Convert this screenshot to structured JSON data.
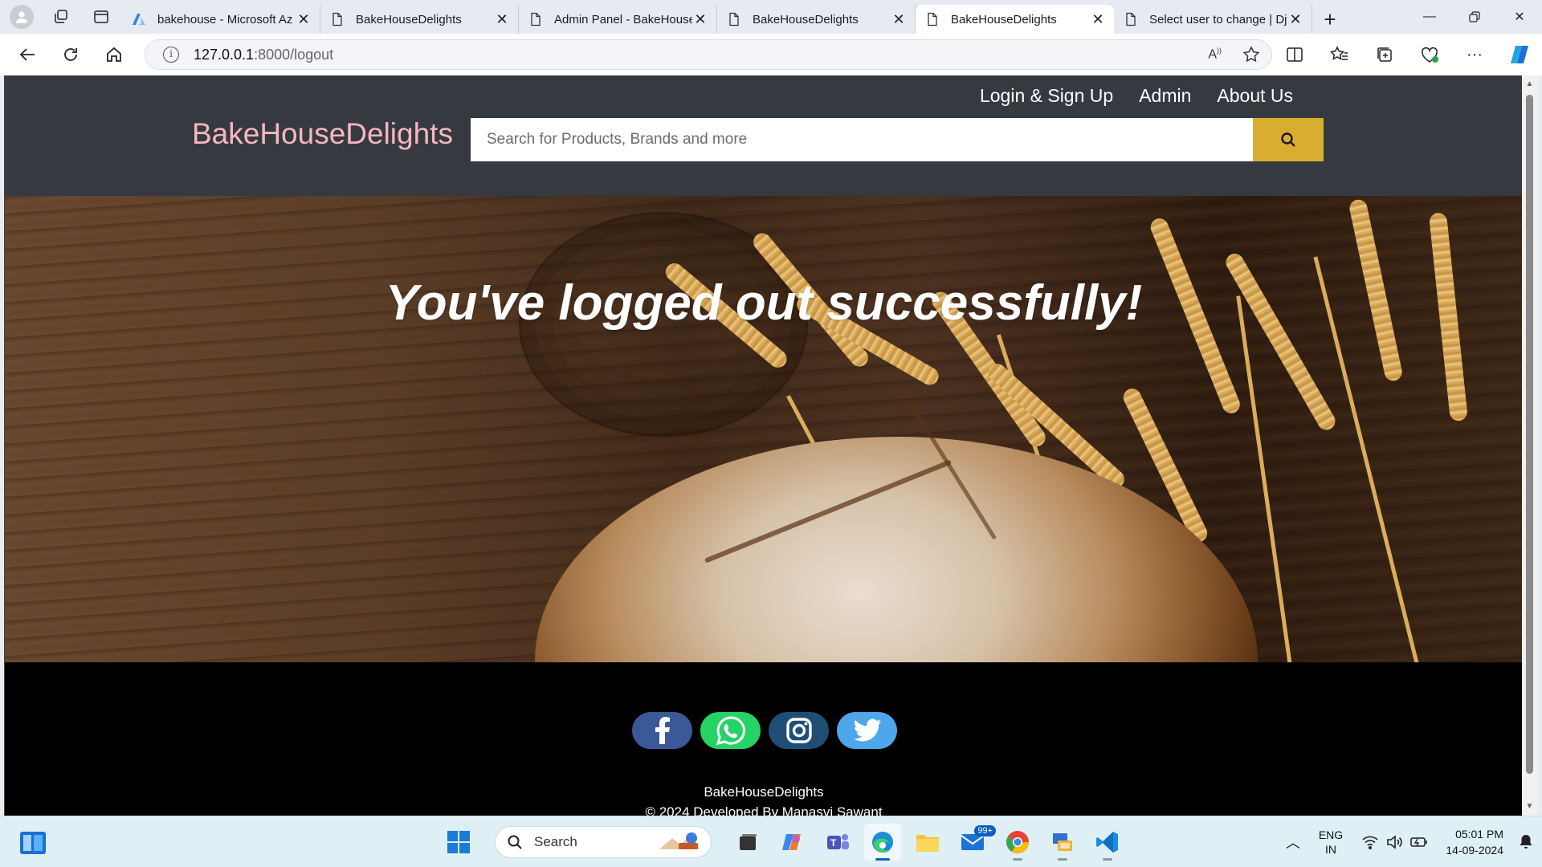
{
  "browser": {
    "tabs": [
      {
        "label": "bakehouse - Microsoft Az",
        "icon": "azure-icon",
        "active": false
      },
      {
        "label": "BakeHouseDelights",
        "icon": "page-icon",
        "active": false
      },
      {
        "label": "Admin Panel - BakeHouse",
        "icon": "page-icon",
        "active": false
      },
      {
        "label": "BakeHouseDelights",
        "icon": "page-icon",
        "active": false
      },
      {
        "label": "BakeHouseDelights",
        "icon": "page-icon",
        "active": true
      },
      {
        "label": "Select user to change | Dj",
        "icon": "page-icon",
        "active": false
      }
    ],
    "url_host": "127.0.0.1",
    "url_path": ":8000/logout"
  },
  "site": {
    "nav": {
      "login": "Login & Sign Up",
      "admin": "Admin",
      "about": "About Us"
    },
    "brand": "BakeHouseDelights",
    "search_placeholder": "Search for Products, Brands and more",
    "hero_title": "You've logged out successfully!",
    "footer": {
      "brand": "BakeHouseDelights",
      "copyright": "© 2024 Developed By Manasvi Sawant",
      "socials": [
        "facebook-icon",
        "whatsapp-icon",
        "instagram-icon",
        "twitter-icon"
      ]
    },
    "colors": {
      "header_bg": "#343a40",
      "brand": "#f7b6c1",
      "search_button": "#d9ad2f",
      "footer_bg": "#000000"
    }
  },
  "taskbar": {
    "search_label": "Search",
    "mail_badge": "99+",
    "lang_top": "ENG",
    "lang_bottom": "IN",
    "time": "05:01 PM",
    "date": "14-09-2024"
  }
}
